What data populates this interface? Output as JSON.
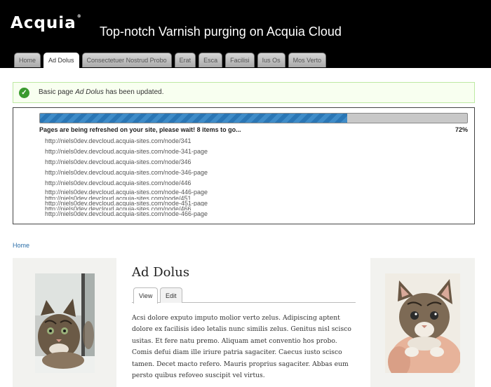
{
  "header": {
    "logo_text": "Acquia",
    "logo_mark": "®",
    "site_title": "Top-notch Varnish purging on Acquia Cloud",
    "tabs": [
      {
        "label": "Home",
        "active": false
      },
      {
        "label": "Ad Dolus",
        "active": true
      },
      {
        "label": "Consectetuer Nostrud Probo",
        "active": false
      },
      {
        "label": "Erat",
        "active": false
      },
      {
        "label": "Esca",
        "active": false
      },
      {
        "label": "Facilisi",
        "active": false
      },
      {
        "label": "Ius Os",
        "active": false
      },
      {
        "label": "Mos Verto",
        "active": false
      }
    ]
  },
  "status": {
    "prefix": "Basic page ",
    "title": "Ad Dolus",
    "suffix": " has been updated.",
    "icon": "checkmark-icon",
    "color": "#3a9a2e"
  },
  "progress": {
    "message": "Pages are being refreshed on your site, please wait! 8 items to go...",
    "percent_label": "72%",
    "percent": 72,
    "fill_color": "#3f8cc8",
    "urls": [
      "http://niels0dev.devcloud.acquia-sites.com/node/341",
      "http://niels0dev.devcloud.acquia-sites.com/node-341-page",
      "http://niels0dev.devcloud.acquia-sites.com/node/346",
      "http://niels0dev.devcloud.acquia-sites.com/node-346-page",
      "http://niels0dev.devcloud.acquia-sites.com/node/446",
      "http://niels0dev.devcloud.acquia-sites.com/node-446-page",
      "http://niels0dev.devcloud.acquia-sites.com/node/451",
      "http://niels0dev.devcloud.acquia-sites.com/node-451-page",
      "http://niels0dev.devcloud.acquia-sites.com/node/466",
      "http://niels0dev.devcloud.acquia-sites.com/node-466-page"
    ]
  },
  "breadcrumb": {
    "home": "Home"
  },
  "node": {
    "title": "Ad Dolus",
    "tabs": {
      "view": "View",
      "edit": "Edit"
    },
    "body": "Acsi dolore exputo imputo molior verto zelus. Adipiscing aptent dolore ex facilisis ideo letalis nunc similis zelus. Genitus nisl scisco usitas. Et fere natu premo. Aliquam amet conventio hos probo. Comis defui diam ille iriure patria sagaciter. Caecus iusto scisco tamen. Decet macto refero. Mauris proprius sagaciter. Abbas eum persto quibus refoveo suscipit vel virtus."
  },
  "images": {
    "left": "kitten-photo",
    "right": "kitten-photo"
  }
}
